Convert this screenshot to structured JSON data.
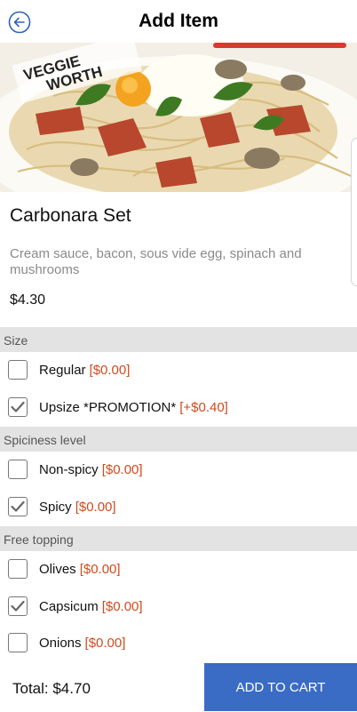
{
  "header": {
    "title": "Add Item",
    "back_icon": "back-arrow-icon"
  },
  "hero": {
    "banner_text_1": "VEGGIE",
    "banner_text_2": "WORTH"
  },
  "product": {
    "name": "Carbonara Set",
    "description": "Cream sauce, bacon, sous vide egg, spinach and mushrooms",
    "price": "$4.30"
  },
  "sections": [
    {
      "title": "Size",
      "options": [
        {
          "label": "Regular",
          "price": "[$0.00]",
          "checked": false
        },
        {
          "label": "Upsize *PROMOTION*",
          "price": "[+$0.40]",
          "checked": true
        }
      ]
    },
    {
      "title": "Spiciness level",
      "options": [
        {
          "label": "Non-spicy",
          "price": "[$0.00]",
          "checked": false
        },
        {
          "label": "Spicy",
          "price": "[$0.00]",
          "checked": true
        }
      ]
    },
    {
      "title": "Free topping",
      "options": [
        {
          "label": "Olives",
          "price": "[$0.00]",
          "checked": false
        },
        {
          "label": "Capsicum",
          "price": "[$0.00]",
          "checked": true
        },
        {
          "label": "Onions",
          "price": "[$0.00]",
          "checked": false
        }
      ]
    }
  ],
  "footer": {
    "total": "Total: $4.70",
    "add_to_cart": "ADD TO CART"
  },
  "colors": {
    "accent": "#3a6cc6",
    "price_red": "#d04a1e",
    "section_bg": "#e3e3e3",
    "back_icon": "#2d63b8"
  }
}
